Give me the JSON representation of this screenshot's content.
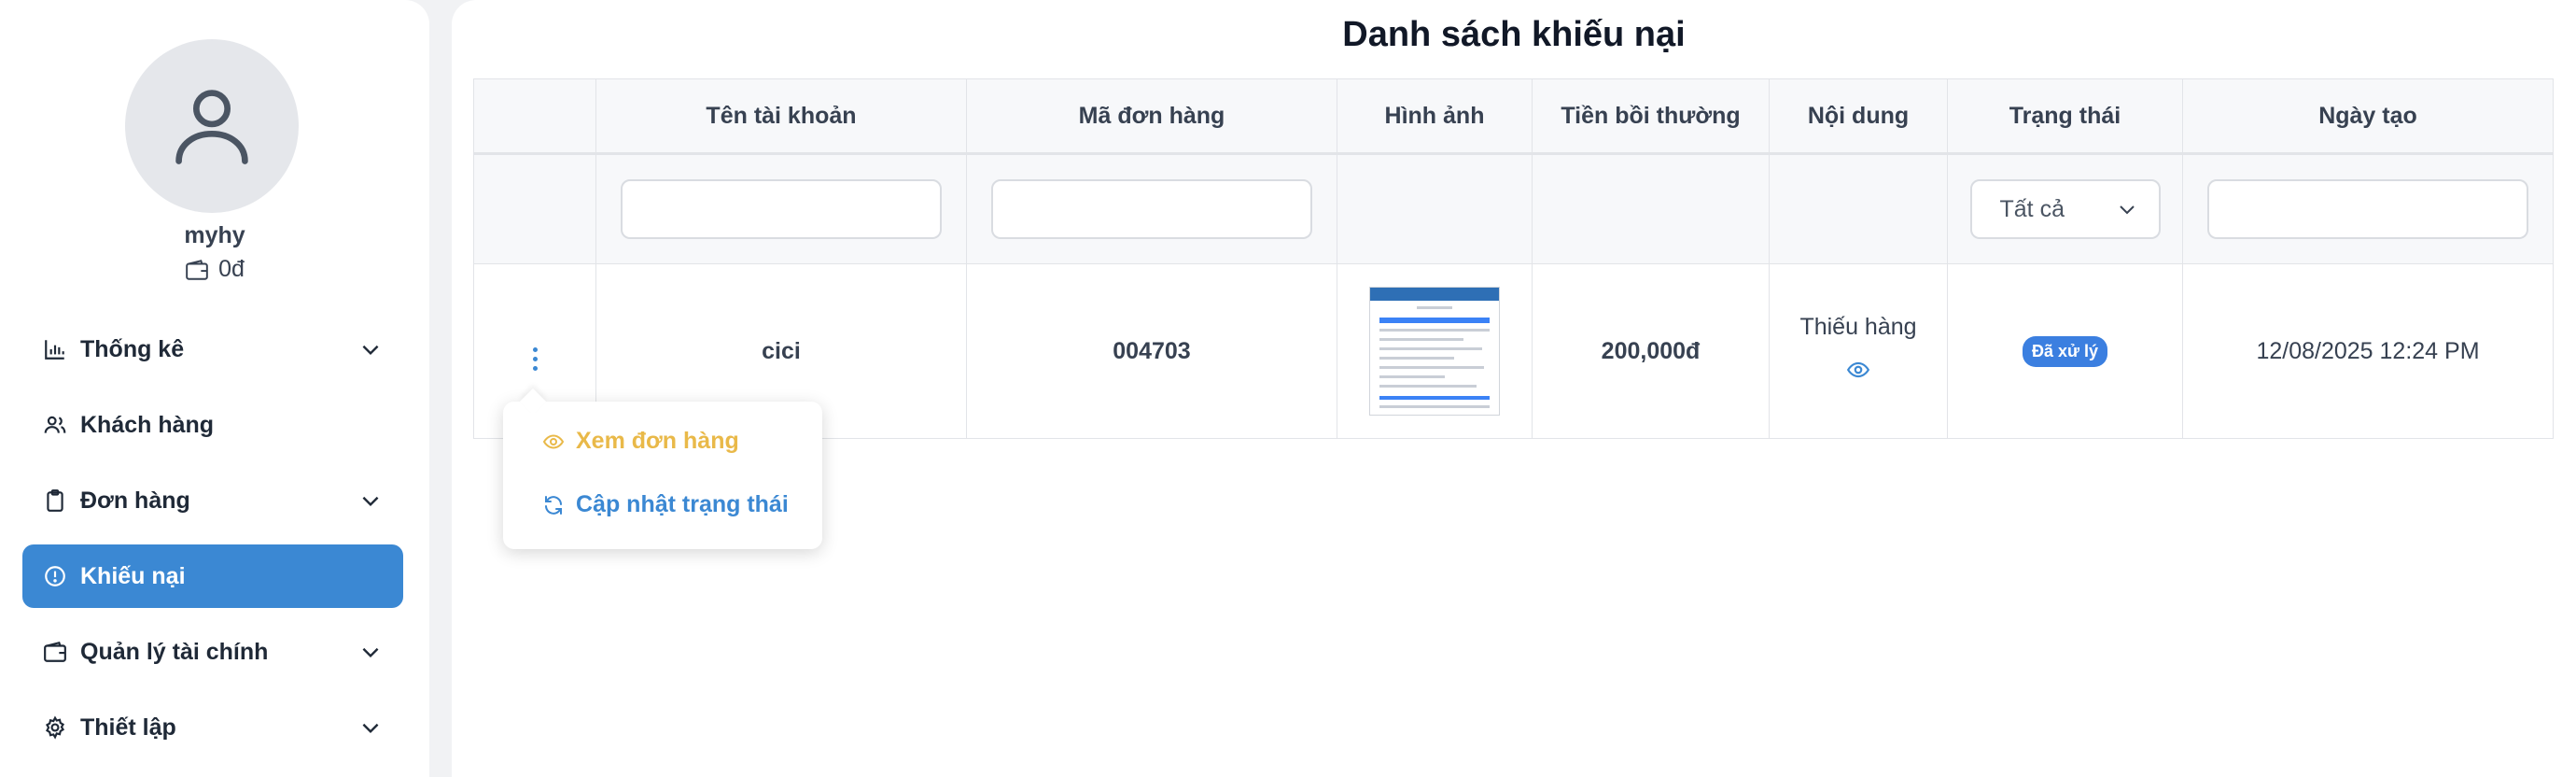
{
  "sidebar": {
    "username": "myhy",
    "balance": "0đ",
    "items": [
      {
        "label": "Thống kê",
        "icon": "bar-chart-icon",
        "has_children": true,
        "active": false
      },
      {
        "label": "Khách hàng",
        "icon": "users-icon",
        "has_children": false,
        "active": false
      },
      {
        "label": "Đơn hàng",
        "icon": "clipboard-icon",
        "has_children": true,
        "active": false
      },
      {
        "label": "Khiếu nại",
        "icon": "alert-circle-icon",
        "has_children": false,
        "active": true
      },
      {
        "label": "Quản lý tài chính",
        "icon": "wallet-icon",
        "has_children": true,
        "active": false
      },
      {
        "label": "Thiết lập",
        "icon": "gear-icon",
        "has_children": true,
        "active": false
      }
    ]
  },
  "main": {
    "title": "Danh sách khiếu nại",
    "columns": [
      "",
      "Tên tài khoản",
      "Mã đơn hàng",
      "Hình ảnh",
      "Tiền bồi thường",
      "Nội dung",
      "Trạng thái",
      "Ngày tạo"
    ],
    "filters": {
      "status_selected": "Tất cả"
    },
    "rows": [
      {
        "account": "cici",
        "order_code": "004703",
        "compensation": "200,000đ",
        "content": "Thiếu hàng",
        "status": "Đã xử lý",
        "created_at": "12/08/2025 12:24 PM"
      }
    ],
    "row_menu": {
      "view_label": "Xem đơn hàng",
      "update_label": "Cập nhật trạng thái"
    }
  },
  "colors": {
    "accent": "#3b88d3",
    "view_action": "#e9b949",
    "status_badge": "#3b7fe0"
  }
}
